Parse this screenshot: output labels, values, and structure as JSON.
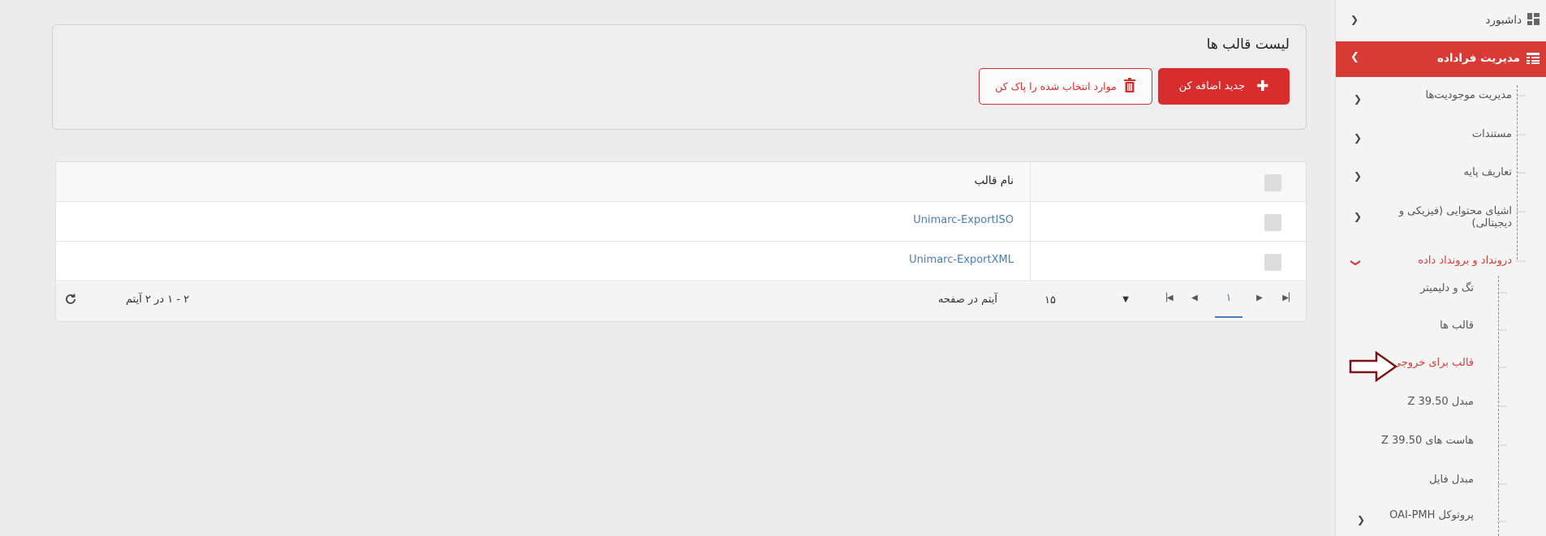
{
  "main": {
    "card_title": "لیست قالب ها",
    "add_button": "جدید اضافه کن",
    "delete_button": "موارد انتخاب شده را پاک کن",
    "grid": {
      "column_name": "نام قالب",
      "rows": [
        "Unimarc-ExportISO",
        "Unimarc-ExportXML"
      ]
    },
    "pager": {
      "current_page": "۱",
      "page_size": "۱۵",
      "items_per_page_label": "آیتم در صفحه",
      "info": "۲ - ۱ در ۲ آیتم"
    }
  },
  "sidebar": {
    "dashboard": "داشبورد",
    "metadata_management": "مدیریت فراداده",
    "items": {
      "entities": "مدیریت موجودیت‌ها",
      "documents": "مستندات",
      "base_definitions": "تعاریف پایه",
      "content_objects": "اشیای محتوایی (فیزیکی و دیجیتالی)",
      "io": "درونداد و برونداد داده"
    },
    "sub_items": {
      "tag_delimiter": "تگ و دلیمیتر",
      "templates": "قالب ها",
      "export_templates": "قالب برای خروجی",
      "z3950_converter": "مبدل Z 39.50",
      "z3950_hosts": "هاست های Z 39.50",
      "file_converter": "مبدل فایل",
      "oai_pmh": "پروتوکل OAI-PMH"
    }
  },
  "colors": {
    "accent_red": "#d82d2d",
    "link_blue": "#4a7bb5",
    "arrow_dark_red": "#7a1515"
  }
}
